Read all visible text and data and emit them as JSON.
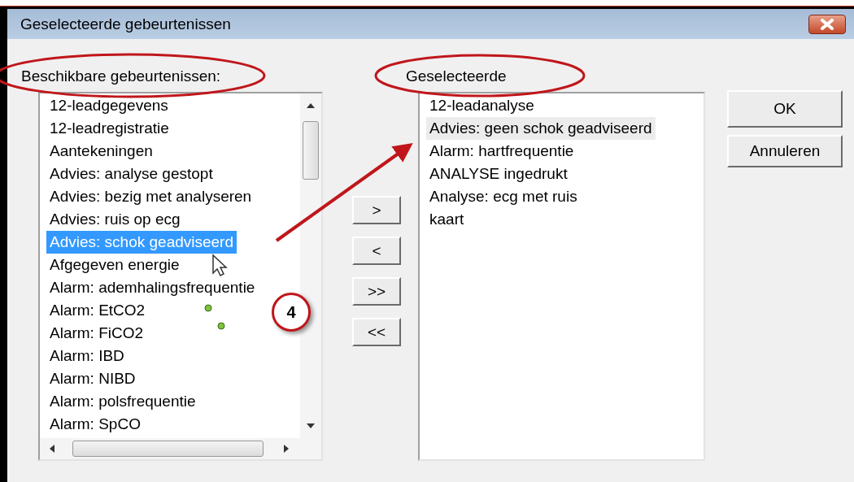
{
  "window": {
    "title": "Geselecteerde gebeurtenissen"
  },
  "available": {
    "label": "Beschikbare gebeurtenissen:",
    "items": [
      {
        "text": "12-leadgegevens",
        "selected": false
      },
      {
        "text": "12-leadregistratie",
        "selected": false
      },
      {
        "text": "Aantekeningen",
        "selected": false
      },
      {
        "text": "Advies: analyse gestopt",
        "selected": false
      },
      {
        "text": "Advies: bezig met analyseren",
        "selected": false
      },
      {
        "text": "Advies: ruis op ecg",
        "selected": false
      },
      {
        "text": "Advies: schok geadviseerd",
        "selected": true
      },
      {
        "text": "Afgegeven energie",
        "selected": false
      },
      {
        "text": "Alarm: ademhalingsfrequentie",
        "selected": false
      },
      {
        "text": "Alarm: EtCO2",
        "selected": false
      },
      {
        "text": "Alarm: FiCO2",
        "selected": false
      },
      {
        "text": "Alarm: IBD",
        "selected": false
      },
      {
        "text": "Alarm: NIBD",
        "selected": false
      },
      {
        "text": "Alarm: polsfrequentie",
        "selected": false
      },
      {
        "text": "Alarm: SpCO",
        "selected": false
      }
    ]
  },
  "move_buttons": [
    ">",
    "<",
    ">>",
    "<<"
  ],
  "selected_list": {
    "label": "Geselecteerde",
    "items": [
      {
        "text": "12-leadanalyse",
        "selected": false
      },
      {
        "text": "Advies: geen schok geadviseerd",
        "selected": true
      },
      {
        "text": "Alarm: hartfrequentie",
        "selected": false
      },
      {
        "text": "ANALYSE ingedrukt",
        "selected": false
      },
      {
        "text": "Analyse: ecg met ruis",
        "selected": false
      },
      {
        "text": "kaart",
        "selected": false
      }
    ]
  },
  "buttons": [
    "OK",
    "Annuleren"
  ],
  "annotation": {
    "callout": "4"
  }
}
